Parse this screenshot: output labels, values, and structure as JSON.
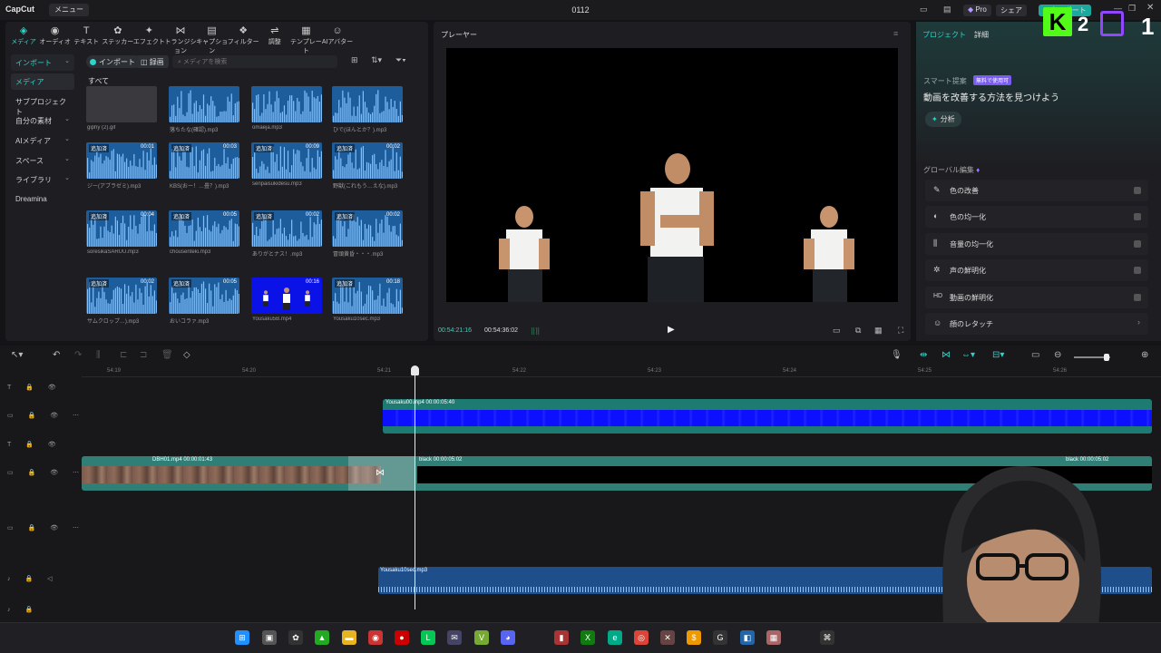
{
  "app": {
    "logo": "CapCut",
    "menu_label": "メニュー",
    "window_title": "0112"
  },
  "titlebar": {
    "pro_label": "Pro",
    "share_label": "シェア",
    "export_label": "エクスポート"
  },
  "toolbar": {
    "tabs": [
      {
        "label": "メディア",
        "icon": "media-icon"
      },
      {
        "label": "オーディオ",
        "icon": "audio-icon"
      },
      {
        "label": "テキスト",
        "icon": "text-icon"
      },
      {
        "label": "ステッカー",
        "icon": "sticker-icon"
      },
      {
        "label": "エフェクト",
        "icon": "effect-icon"
      },
      {
        "label": "トランジション",
        "icon": "transition-icon"
      },
      {
        "label": "キャプション",
        "icon": "caption-icon"
      },
      {
        "label": "フィルター",
        "icon": "filter-icon"
      },
      {
        "label": "調整",
        "icon": "adjust-icon"
      },
      {
        "label": "テンプレート",
        "icon": "template-icon"
      },
      {
        "label": "AIアバター",
        "icon": "avatar-icon"
      }
    ]
  },
  "sidebar": {
    "items": [
      {
        "label": "インポート",
        "chevron": true
      },
      {
        "label": "メディア",
        "chevron": false
      },
      {
        "label": "サブプロジェクト",
        "chevron": false
      },
      {
        "label": "自分の素材",
        "chevron": true
      },
      {
        "label": "AIメディア",
        "chevron": true
      },
      {
        "label": "スペース",
        "chevron": true
      },
      {
        "label": "ライブラリ",
        "chevron": true
      },
      {
        "label": "Dreamina",
        "chevron": false
      }
    ]
  },
  "media": {
    "import_label": "インポート",
    "record_label": "録画",
    "search_placeholder": "メディアを検索",
    "all_label": "すべて",
    "items": [
      {
        "name": "giphy (2).gif",
        "type": "gif",
        "added": "",
        "duration": ""
      },
      {
        "name": "落ちたな(確認).mp3",
        "type": "audio",
        "added": "",
        "duration": ""
      },
      {
        "name": "omaeja.mp3",
        "type": "audio",
        "added": "",
        "duration": ""
      },
      {
        "name": "ひで(ほんとか？).mp3",
        "type": "audio",
        "added": "",
        "duration": ""
      },
      {
        "name": "ジー(アブラゼミ).mp3",
        "type": "audio",
        "added": "追加済",
        "duration": "00:01"
      },
      {
        "name": "KBS(おー！…畳？).mp3",
        "type": "audio",
        "added": "追加済",
        "duration": "00:03"
      },
      {
        "name": "senpaisukidesu.mp3",
        "type": "audio",
        "added": "追加済",
        "duration": "00:09"
      },
      {
        "name": "野獣(これもう…えな).mp3",
        "type": "audio",
        "added": "追加済",
        "duration": "00:02"
      },
      {
        "name": "soresikaSARUU.mp3",
        "type": "audio",
        "added": "追加済",
        "duration": "00:04"
      },
      {
        "name": "chousenteki.mp3",
        "type": "audio",
        "added": "追加済",
        "duration": "00:05"
      },
      {
        "name": "ありがとナス！.mp3",
        "type": "audio",
        "added": "追加済",
        "duration": "00:02"
      },
      {
        "name": "冒頭黄昏・・・.mp3",
        "type": "audio",
        "added": "追加済",
        "duration": "00:02"
      },
      {
        "name": "サムクロップ…).mp3",
        "type": "audio",
        "added": "追加済",
        "duration": "00:02"
      },
      {
        "name": "おいコラァ.mp3",
        "type": "audio",
        "added": "追加済",
        "duration": "00:05"
      },
      {
        "name": "Yousaku5B.mp4",
        "type": "video",
        "added": "",
        "duration": "00:16"
      },
      {
        "name": "Yousaku10sec.mp3",
        "type": "audio",
        "added": "追加済",
        "duration": "00:18"
      }
    ]
  },
  "player": {
    "title": "プレーヤー",
    "current_time": "00:54:21:16",
    "total_time": "00:54:36:02"
  },
  "right_panel": {
    "tabs": [
      "プロジェクト",
      "詳細"
    ],
    "smart_title": "スマート提案",
    "smart_badge": "無料で使用可",
    "smart_desc": "動画を改善する方法を見つけよう",
    "analyze_label": "分析",
    "global_title": "グローバル編集",
    "features": [
      {
        "label": "色の改善",
        "icon": "color-wand-icon",
        "toggle": true
      },
      {
        "label": "色の均一化",
        "icon": "color-match-icon",
        "toggle": true
      },
      {
        "label": "音量の均一化",
        "icon": "volume-icon",
        "toggle": true
      },
      {
        "label": "声の鮮明化",
        "icon": "voice-icon",
        "toggle": true
      },
      {
        "label": "動画の鮮明化",
        "icon": "hd-icon",
        "glyph": "HD",
        "toggle": true
      },
      {
        "label": "顔のレタッチ",
        "icon": "face-icon",
        "toggle": false
      }
    ]
  },
  "overlay": {
    "kick_count": "2",
    "twitch_count": "1"
  },
  "timeline": {
    "ruler_ticks": [
      "54:19",
      "54:20",
      "54:21",
      "54:22",
      "54:23",
      "54:24",
      "54:25",
      "54:26"
    ],
    "clips": {
      "top": {
        "label": "Yousaku00.mp4  00:00:05:40"
      },
      "main": {
        "label": "DBH01.mp4  00:00:01:43"
      },
      "black1": {
        "label": "black  00:00:05:02"
      },
      "black2": {
        "label": "black  00:00:05:02"
      },
      "audio": {
        "label": "Yousaku10sec.mp3"
      }
    }
  },
  "colors": {
    "accent": "#2bd5c7",
    "audio_clip": "#1e5d9b",
    "video_clip": "#1e7b72",
    "pro_badge": "#7b5cf2"
  }
}
